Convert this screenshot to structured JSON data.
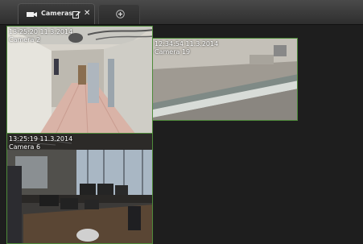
{
  "tabs": {
    "active_label": "Cameras"
  },
  "views": [
    {
      "timestamp": "13:25:20  11.3.2014",
      "camera": "Camera 2"
    },
    {
      "timestamp": "12:34:54  11.3.2014",
      "camera": "Camera 19"
    },
    {
      "timestamp": "13:25:19  11.3.2014",
      "camera": "Camera 6"
    }
  ],
  "colors": {
    "tile_border": "#4e8a3a",
    "background": "#1c1c1c"
  },
  "icons": {
    "tab_icon": "camera-icon",
    "edit": "edit-icon",
    "close": "close-icon",
    "new_tab": "add-tab-icon"
  }
}
